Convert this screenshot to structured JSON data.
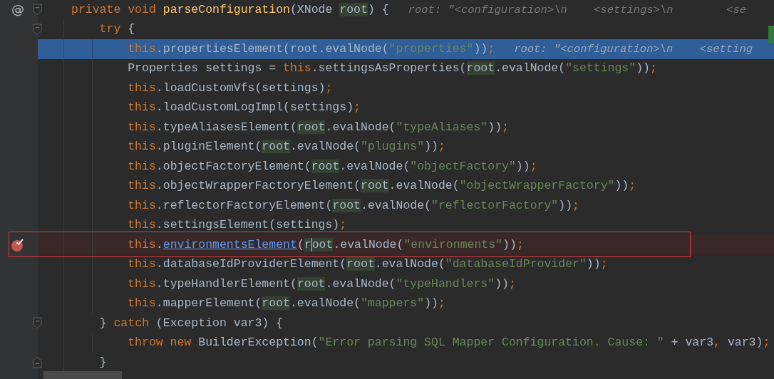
{
  "editor": {
    "lines": [
      {
        "gutter_mark": "@",
        "fold_start": true,
        "tokens": [
          {
            "text": "private void ",
            "kind": "keyword"
          },
          {
            "text": "parseConfiguration",
            "kind": "function"
          },
          {
            "text": "(XNode ",
            "kind": "plain"
          },
          {
            "text": "root",
            "kind": "usage"
          },
          {
            "text": ") {",
            "kind": "plain"
          }
        ],
        "hint": "root: \"<configuration>\\n    <settings>\\n        <se"
      },
      {
        "fold_start": true,
        "change_mark": true,
        "tokens": [
          {
            "text": "    try ",
            "kind": "keyword"
          },
          {
            "text": "{",
            "kind": "plain"
          }
        ]
      },
      {
        "current": true,
        "tokens": [
          {
            "text": "        this",
            "kind": "keyword"
          },
          {
            "text": ".propertiesElement(root.evalNode(",
            "kind": "plain"
          },
          {
            "text": "\"properties\"",
            "kind": "string"
          },
          {
            "text": "))",
            "kind": "plain"
          },
          {
            "text": ";",
            "kind": "keyword"
          }
        ],
        "hint": "root: \"<configuration>\\n    <setting"
      },
      {
        "tokens": [
          {
            "text": "        Properties settings = ",
            "kind": "plain"
          },
          {
            "text": "this",
            "kind": "keyword"
          },
          {
            "text": ".settingsAsProperties(",
            "kind": "plain"
          },
          {
            "text": "root",
            "kind": "usage"
          },
          {
            "text": ".evalNode(",
            "kind": "plain"
          },
          {
            "text": "\"settings\"",
            "kind": "string"
          },
          {
            "text": "))",
            "kind": "plain"
          },
          {
            "text": ";",
            "kind": "keyword"
          }
        ]
      },
      {
        "tokens": [
          {
            "text": "        this",
            "kind": "keyword"
          },
          {
            "text": ".loadCustomVfs(settings)",
            "kind": "plain"
          },
          {
            "text": ";",
            "kind": "keyword"
          }
        ]
      },
      {
        "tokens": [
          {
            "text": "        this",
            "kind": "keyword"
          },
          {
            "text": ".loadCustomLogImpl(settings)",
            "kind": "plain"
          },
          {
            "text": ";",
            "kind": "keyword"
          }
        ]
      },
      {
        "tokens": [
          {
            "text": "        this",
            "kind": "keyword"
          },
          {
            "text": ".typeAliasesElement(",
            "kind": "plain"
          },
          {
            "text": "root",
            "kind": "usage"
          },
          {
            "text": ".evalNode(",
            "kind": "plain"
          },
          {
            "text": "\"typeAliases\"",
            "kind": "string"
          },
          {
            "text": "))",
            "kind": "plain"
          },
          {
            "text": ";",
            "kind": "keyword"
          }
        ]
      },
      {
        "tokens": [
          {
            "text": "        this",
            "kind": "keyword"
          },
          {
            "text": ".pluginElement(",
            "kind": "plain"
          },
          {
            "text": "root",
            "kind": "usage"
          },
          {
            "text": ".evalNode(",
            "kind": "plain"
          },
          {
            "text": "\"plugins\"",
            "kind": "string"
          },
          {
            "text": "))",
            "kind": "plain"
          },
          {
            "text": ";",
            "kind": "keyword"
          }
        ]
      },
      {
        "tokens": [
          {
            "text": "        this",
            "kind": "keyword"
          },
          {
            "text": ".objectFactoryElement(",
            "kind": "plain"
          },
          {
            "text": "root",
            "kind": "usage"
          },
          {
            "text": ".evalNode(",
            "kind": "plain"
          },
          {
            "text": "\"objectFactory\"",
            "kind": "string"
          },
          {
            "text": "))",
            "kind": "plain"
          },
          {
            "text": ";",
            "kind": "keyword"
          }
        ]
      },
      {
        "tokens": [
          {
            "text": "        this",
            "kind": "keyword"
          },
          {
            "text": ".objectWrapperFactoryElement(",
            "kind": "plain"
          },
          {
            "text": "root",
            "kind": "usage"
          },
          {
            "text": ".evalNode(",
            "kind": "plain"
          },
          {
            "text": "\"objectWrapperFactory\"",
            "kind": "string"
          },
          {
            "text": "))",
            "kind": "plain"
          },
          {
            "text": ";",
            "kind": "keyword"
          }
        ]
      },
      {
        "tokens": [
          {
            "text": "        this",
            "kind": "keyword"
          },
          {
            "text": ".reflectorFactoryElement(",
            "kind": "plain"
          },
          {
            "text": "root",
            "kind": "usage"
          },
          {
            "text": ".evalNode(",
            "kind": "plain"
          },
          {
            "text": "\"reflectorFactory\"",
            "kind": "string"
          },
          {
            "text": "))",
            "kind": "plain"
          },
          {
            "text": ";",
            "kind": "keyword"
          }
        ]
      },
      {
        "tokens": [
          {
            "text": "        this",
            "kind": "keyword"
          },
          {
            "text": ".settingsElement(settings)",
            "kind": "plain"
          },
          {
            "text": ";",
            "kind": "keyword"
          }
        ]
      },
      {
        "breakpoint": true,
        "framed": true,
        "tokens": [
          {
            "text": "        this",
            "kind": "keyword"
          },
          {
            "text": ".",
            "kind": "plain"
          },
          {
            "text": "environmentsElement",
            "kind": "link"
          },
          {
            "text": "(",
            "kind": "plain"
          },
          {
            "text": "r",
            "kind": "caret"
          },
          {
            "text": "oot",
            "kind": "usage"
          },
          {
            "text": ".evalNode(",
            "kind": "plain"
          },
          {
            "text": "\"environments\"",
            "kind": "string"
          },
          {
            "text": "))",
            "kind": "plain"
          },
          {
            "text": ";",
            "kind": "keyword"
          }
        ]
      },
      {
        "tokens": [
          {
            "text": "        this",
            "kind": "keyword"
          },
          {
            "text": ".databaseIdProviderElement(",
            "kind": "plain"
          },
          {
            "text": "root",
            "kind": "usage"
          },
          {
            "text": ".evalNode(",
            "kind": "plain"
          },
          {
            "text": "\"databaseIdProvider\"",
            "kind": "string"
          },
          {
            "text": "))",
            "kind": "plain"
          },
          {
            "text": ";",
            "kind": "keyword"
          }
        ]
      },
      {
        "tokens": [
          {
            "text": "        this",
            "kind": "keyword"
          },
          {
            "text": ".typeHandlerElement(",
            "kind": "plain"
          },
          {
            "text": "root",
            "kind": "usage"
          },
          {
            "text": ".evalNode(",
            "kind": "plain"
          },
          {
            "text": "\"typeHandlers\"",
            "kind": "string"
          },
          {
            "text": "))",
            "kind": "plain"
          },
          {
            "text": ";",
            "kind": "keyword"
          }
        ]
      },
      {
        "tokens": [
          {
            "text": "        this",
            "kind": "keyword"
          },
          {
            "text": ".mapperElement(",
            "kind": "plain"
          },
          {
            "text": "root",
            "kind": "usage"
          },
          {
            "text": ".evalNode(",
            "kind": "plain"
          },
          {
            "text": "\"mappers\"",
            "kind": "string"
          },
          {
            "text": "))",
            "kind": "plain"
          },
          {
            "text": ";",
            "kind": "keyword"
          }
        ]
      },
      {
        "fold_start": true,
        "tokens": [
          {
            "text": "    } ",
            "kind": "plain"
          },
          {
            "text": "catch ",
            "kind": "keyword"
          },
          {
            "text": "(Exception var3) {",
            "kind": "plain"
          }
        ]
      },
      {
        "tokens": [
          {
            "text": "        throw new ",
            "kind": "keyword"
          },
          {
            "text": "BuilderException(",
            "kind": "plain"
          },
          {
            "text": "\"Error parsing SQL Mapper Configuration. Cause: \"",
            "kind": "string"
          },
          {
            "text": " + var3",
            "kind": "plain"
          },
          {
            "text": ", ",
            "kind": "keyword"
          },
          {
            "text": "var3)",
            "kind": "plain"
          },
          {
            "text": ";",
            "kind": "keyword"
          }
        ]
      },
      {
        "fold_end": true,
        "tokens": [
          {
            "text": "    }",
            "kind": "plain"
          }
        ]
      }
    ]
  }
}
